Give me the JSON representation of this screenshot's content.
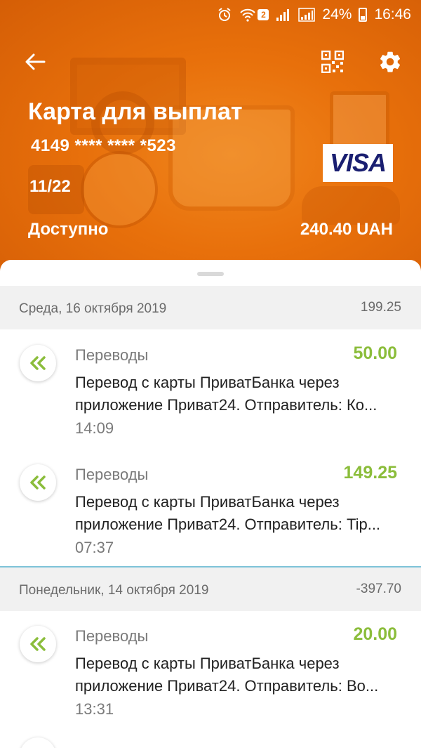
{
  "status_bar": {
    "sim_badge": "2",
    "battery_percent": "24%",
    "time": "16:46"
  },
  "header": {
    "card_title": "Карта для выплат",
    "card_number": "4149 **** **** *523",
    "expiry": "11/22",
    "card_brand": "VISA",
    "available_label": "Доступно",
    "available_value": "240.40 UAH"
  },
  "days": [
    {
      "date": "Среда, 16 октября 2019",
      "sum": "199.25",
      "transactions": [
        {
          "category": "Переводы",
          "amount": "50.00",
          "desc_line1": "Перевод с карты ПриватБанка через",
          "desc_line2": "приложение Приват24. Отправитель: Ко...",
          "time": "14:09"
        },
        {
          "category": "Переводы",
          "amount": "149.25",
          "desc_line1": "Перевод с карты ПриватБанка через",
          "desc_line2": "приложение Приват24. Отправитель: Tip...",
          "time": "07:37"
        }
      ]
    },
    {
      "date": "Понедельник, 14 октября 2019",
      "sum": "-397.70",
      "transactions": [
        {
          "category": "Переводы",
          "amount": "20.00",
          "desc_line1": "Перевод с карты ПриватБанка через",
          "desc_line2": "приложение Приват24. Отправитель: Во...",
          "time": "13:31"
        }
      ]
    }
  ],
  "colors": {
    "header_orange": "#e8700b",
    "amount_green": "#8bbd3b",
    "divider_blue": "#7ec3d8"
  }
}
